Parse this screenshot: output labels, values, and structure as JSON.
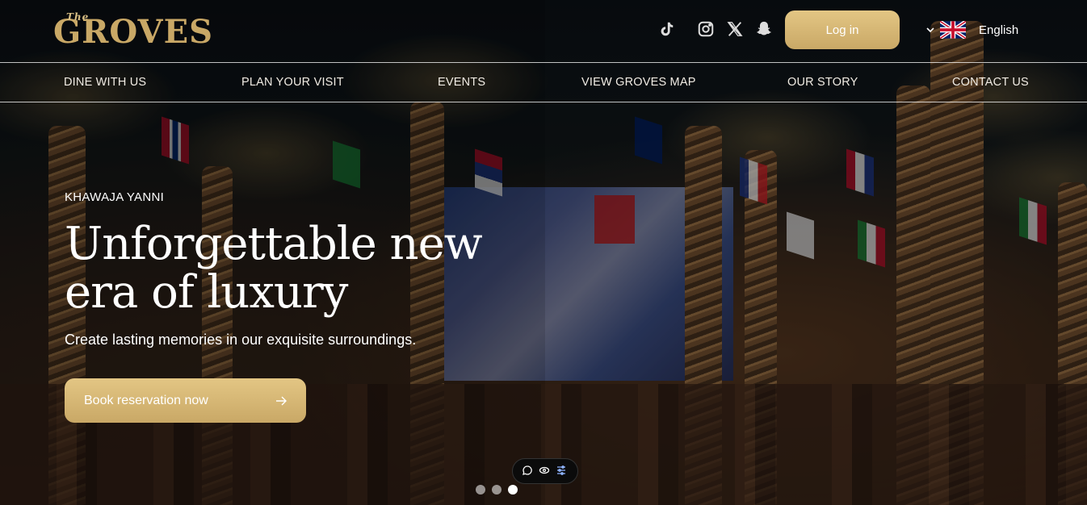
{
  "brand": {
    "logo_small": "The",
    "logo_main": "GROVES"
  },
  "header": {
    "social": [
      "tiktok-icon",
      "instagram-icon",
      "x-icon",
      "snapchat-icon"
    ],
    "login_label": "Log in",
    "language": {
      "selected": "English",
      "flag": "uk-flag-icon"
    }
  },
  "nav": {
    "items": [
      {
        "label": "DINE WITH US"
      },
      {
        "label": "PLAN YOUR VISIT"
      },
      {
        "label": "EVENTS"
      },
      {
        "label": "VIEW GROVES MAP"
      },
      {
        "label": "OUR STORY"
      },
      {
        "label": "CONTACT US"
      }
    ]
  },
  "hero": {
    "eyebrow": "KHAWAJA YANNI",
    "headline_line1": "Unforgettable new",
    "headline_line2": "era of luxury",
    "subline": "Create lasting memories in our exquisite surroundings.",
    "cta_label": "Book reservation now",
    "cta_icon": "arrow-right-icon"
  },
  "widget": {
    "icons": [
      "chat-icon",
      "eye-icon",
      "sliders-icon"
    ]
  },
  "carousel": {
    "count": 3,
    "active": 3
  },
  "colors": {
    "gold": "#c9a866",
    "gold_light": "#e3c684"
  }
}
